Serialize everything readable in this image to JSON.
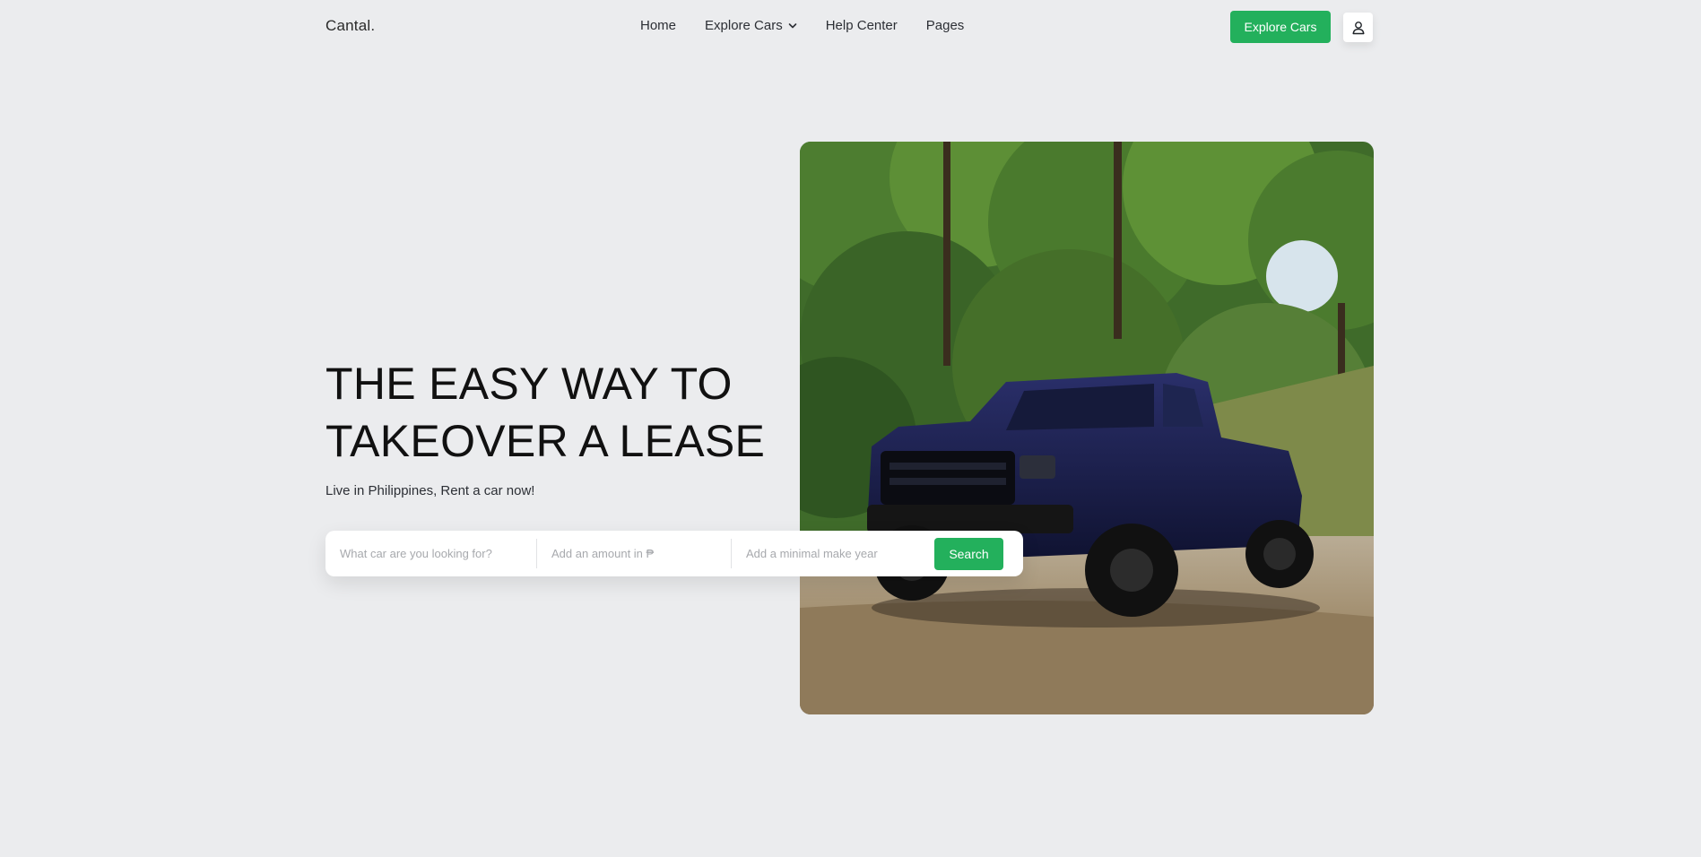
{
  "brand": "Cantal.",
  "nav": {
    "items": [
      {
        "label": "Home"
      },
      {
        "label": "Explore Cars",
        "has_dropdown": true
      },
      {
        "label": "Help Center"
      },
      {
        "label": "Pages"
      }
    ],
    "cta_label": "Explore Cars",
    "user_icon": "user-icon"
  },
  "hero": {
    "title_line1": "THE EASY WAY TO",
    "title_line2": "TAKEOVER A LEASE",
    "subtitle": "Live in Philippines, Rent a car now!",
    "image_icon": "pickup-truck-photo"
  },
  "search": {
    "car_placeholder": "What car are you looking for?",
    "amount_placeholder": "Add an amount in ₱",
    "year_placeholder": "Add a minimal make year",
    "button_label": "Search"
  },
  "colors": {
    "accent": "#23b05c",
    "background": "#ebecee"
  }
}
